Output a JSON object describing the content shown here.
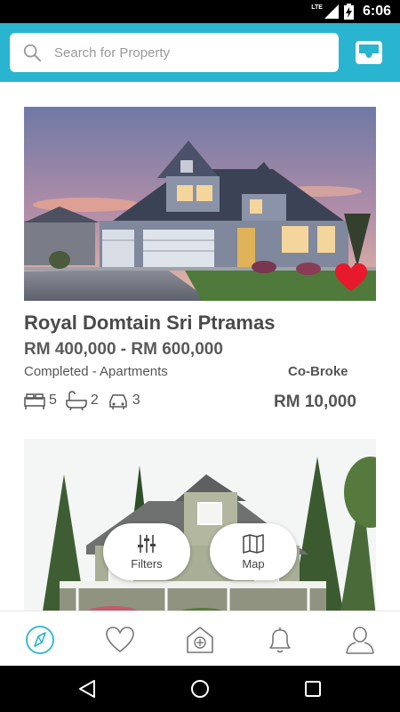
{
  "status_bar": {
    "network": "LTE",
    "time": "6:06"
  },
  "search": {
    "placeholder": "Search for Property",
    "value": ""
  },
  "listings": [
    {
      "title": "Royal Domtain Sri Ptramas",
      "price_range": "RM 400,000 - RM 600,000",
      "property_type": "Completed - Apartments",
      "co_broke_label": "Co-Broke",
      "commission": "RM 10,000",
      "bedrooms": "5",
      "bathrooms": "2",
      "parking": "3",
      "favorited": true
    }
  ],
  "floating_actions": {
    "filters_label": "Filters",
    "map_label": "Map"
  },
  "bottom_nav": {
    "items": [
      "explore-icon",
      "heart-icon",
      "add-property-icon",
      "bell-icon",
      "user-icon"
    ],
    "active_color": "#29b5cf"
  },
  "colors": {
    "accent": "#29b5cf",
    "favorite": "#e8192c"
  }
}
